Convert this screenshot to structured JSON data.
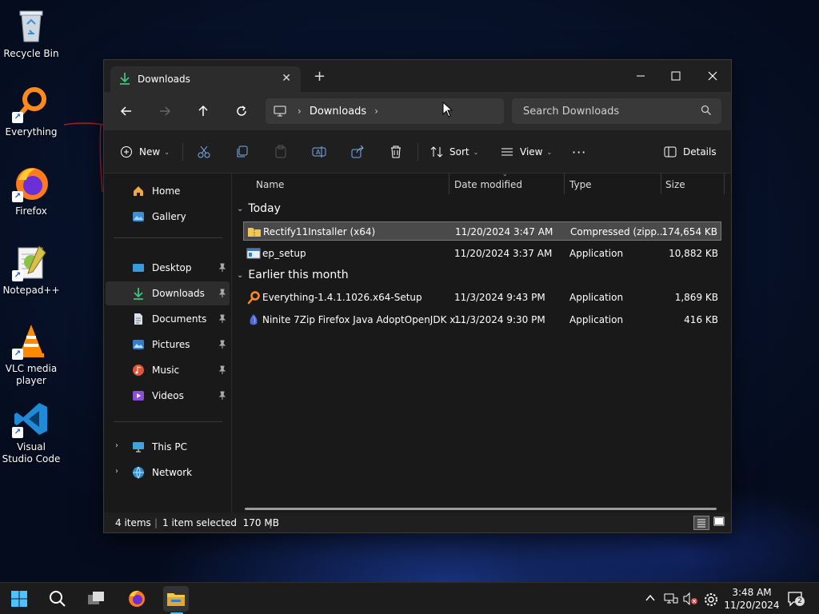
{
  "desktop": {
    "icons": [
      {
        "label": "Recycle Bin",
        "icon": "recycle-bin-icon"
      },
      {
        "label": "Everything",
        "icon": "everything-search-icon"
      },
      {
        "label": "Firefox",
        "icon": "firefox-icon"
      },
      {
        "label": "Notepad++",
        "icon": "notepad-plus-plus-icon"
      },
      {
        "label": "VLC media player",
        "icon": "vlc-icon"
      },
      {
        "label": "Visual Studio Code",
        "icon": "vscode-icon"
      }
    ]
  },
  "window": {
    "tab_title": "Downloads",
    "new_tab_glyph": "+",
    "controls": {
      "minimize": "minimize-icon",
      "maximize": "maximize-icon",
      "close": "close-icon"
    }
  },
  "navbar": {
    "breadcrumb": [
      "Downloads"
    ],
    "search_placeholder": "Search Downloads"
  },
  "toolbar": {
    "new_label": "New",
    "sort_label": "Sort",
    "view_label": "View",
    "details_label": "Details",
    "more_glyph": "···"
  },
  "sidebar": {
    "top_items": [
      {
        "label": "Home",
        "icon": "home-icon"
      },
      {
        "label": "Gallery",
        "icon": "gallery-icon"
      }
    ],
    "quick_access": [
      {
        "label": "Desktop",
        "icon": "desktop-folder-icon",
        "pinned": true
      },
      {
        "label": "Downloads",
        "icon": "downloads-folder-icon",
        "pinned": true,
        "active": true
      },
      {
        "label": "Documents",
        "icon": "documents-folder-icon",
        "pinned": true
      },
      {
        "label": "Pictures",
        "icon": "pictures-folder-icon",
        "pinned": true
      },
      {
        "label": "Music",
        "icon": "music-folder-icon",
        "pinned": true
      },
      {
        "label": "Videos",
        "icon": "videos-folder-icon",
        "pinned": true
      }
    ],
    "locations": [
      {
        "label": "This PC",
        "icon": "this-pc-icon"
      },
      {
        "label": "Network",
        "icon": "network-icon"
      }
    ]
  },
  "filelist": {
    "columns": [
      "Name",
      "Date modified",
      "Type",
      "Size"
    ],
    "groups": [
      {
        "title": "Today",
        "files": [
          {
            "name": "Rectify11Installer (x64)",
            "date": "11/20/2024 3:47 AM",
            "type": "Compressed (zipp...",
            "size": "174,654 KB",
            "icon": "zip-folder-icon",
            "selected": true
          },
          {
            "name": "ep_setup",
            "date": "11/20/2024 3:37 AM",
            "type": "Application",
            "size": "10,882 KB",
            "icon": "application-icon",
            "selected": false
          }
        ]
      },
      {
        "title": "Earlier this month",
        "files": [
          {
            "name": "Everything-1.4.1.1026.x64-Setup",
            "date": "11/3/2024 9:43 PM",
            "type": "Application",
            "size": "1,869 KB",
            "icon": "everything-search-icon",
            "selected": false
          },
          {
            "name": "Ninite 7Zip Firefox Java AdoptOpenJDK x...",
            "date": "11/3/2024 9:30 PM",
            "type": "Application",
            "size": "416 KB",
            "icon": "ninite-icon",
            "selected": false
          }
        ]
      }
    ]
  },
  "statusbar": {
    "item_count": "4 items",
    "selection": "1 item selected  170 MB"
  },
  "taskbar": {
    "time": "3:48 AM",
    "date": "11/20/2024",
    "notification_count": "2"
  },
  "colors": {
    "accent": "#4cc2ff",
    "folder_yellow": "#f3c74f",
    "window_bg": "#191919"
  }
}
